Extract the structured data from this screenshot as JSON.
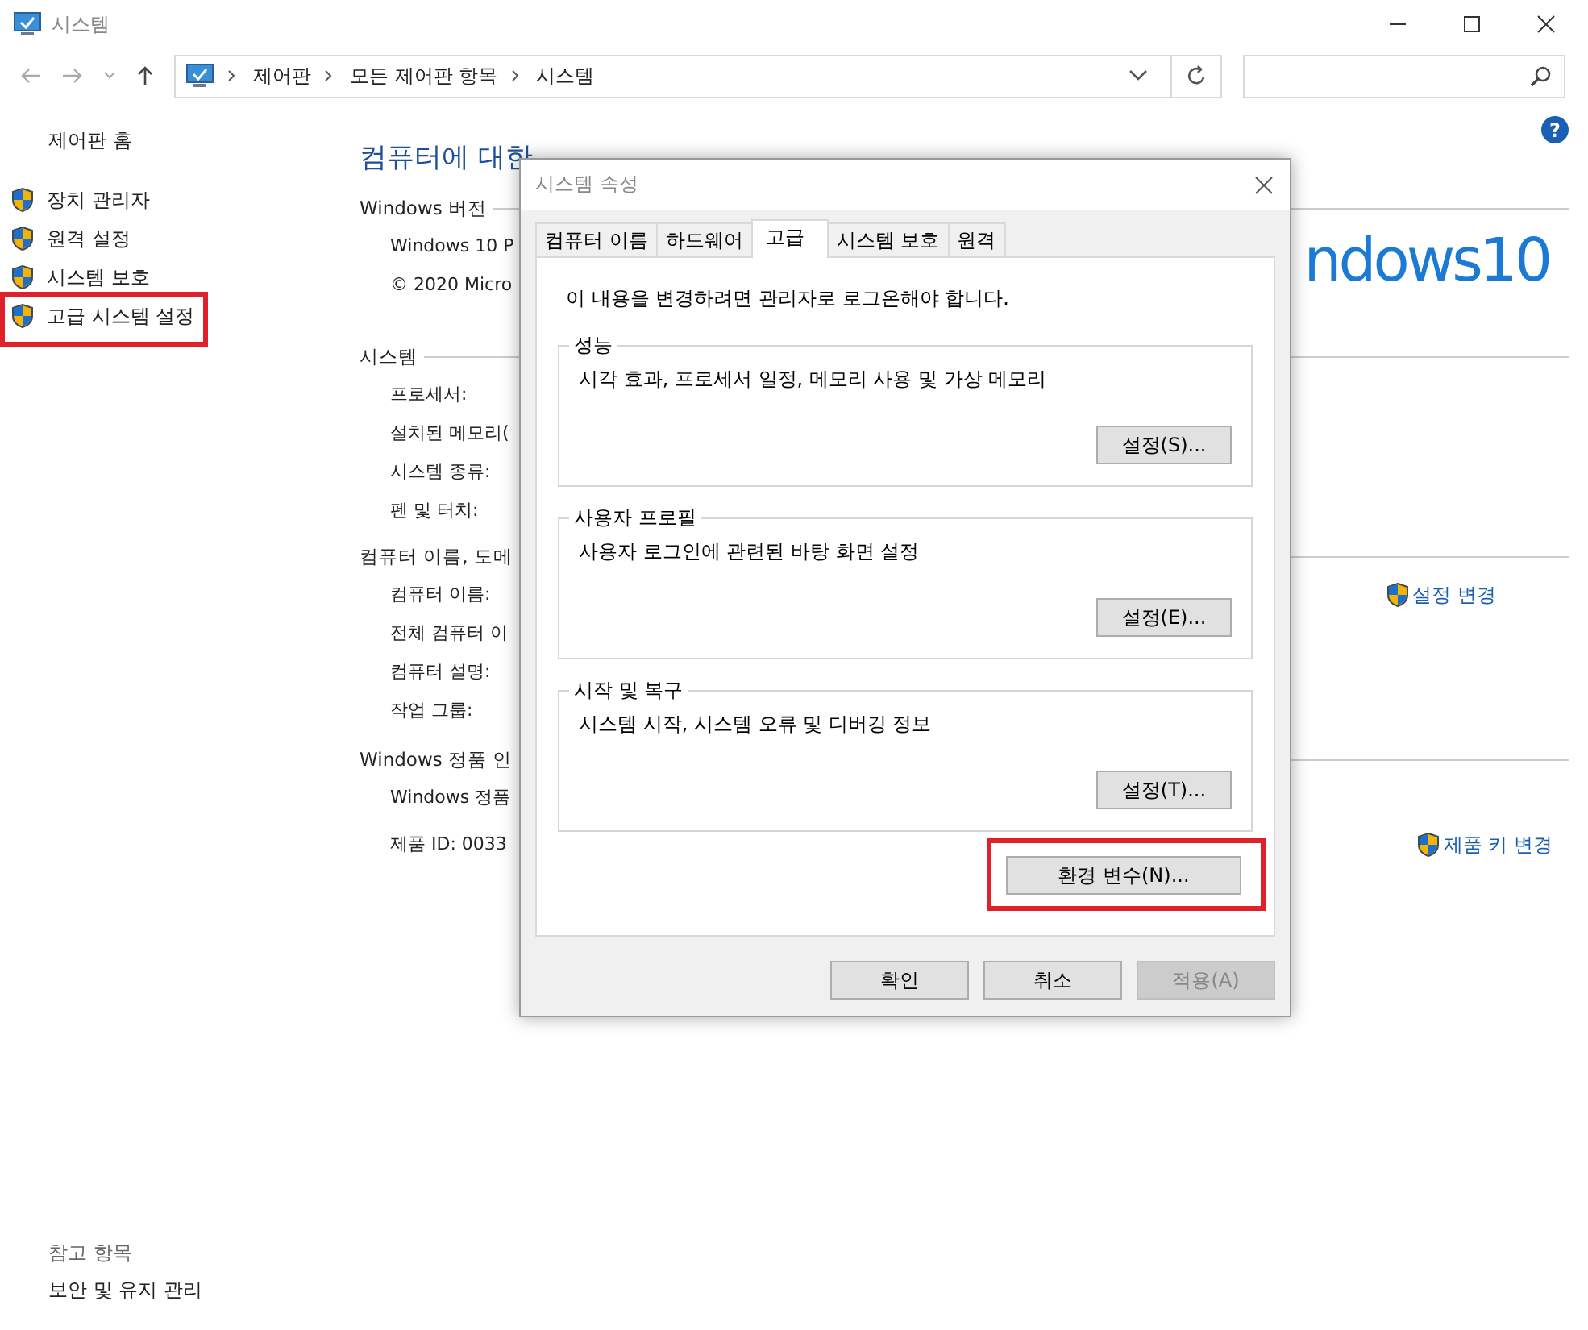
{
  "window": {
    "title": "시스템"
  },
  "nav": {
    "breadcrumb": [
      "제어판",
      "모든 제어판 항목",
      "시스템"
    ]
  },
  "help": "?",
  "sidebar": {
    "home": "제어판 홈",
    "items": [
      {
        "label": "장치 관리자",
        "highlighted": false
      },
      {
        "label": "원격 설정",
        "highlighted": false
      },
      {
        "label": "시스템 보호",
        "highlighted": false
      },
      {
        "label": "고급 시스템 설정",
        "highlighted": true
      }
    ],
    "see_also_title": "참고 항목",
    "see_also": [
      "보안 및 유지 관리"
    ]
  },
  "main": {
    "heading": "컴퓨터에 대한",
    "logo": "ndows10",
    "sections": [
      {
        "title": "Windows 버전",
        "rows": [
          "Windows 10 P",
          "© 2020 Micro"
        ]
      },
      {
        "title": "시스템",
        "rows": [
          "프로세서:",
          "설치된 메모리(",
          "시스템 종류:",
          "펜 및 터치:"
        ]
      },
      {
        "title": "컴퓨터 이름, 도메",
        "rows": [
          "컴퓨터 이름:",
          "전체 컴퓨터 이",
          "컴퓨터 설명:",
          "작업 그룹:"
        ],
        "link": "설정 변경"
      },
      {
        "title": "Windows 정품 인",
        "rows": [
          "Windows 정품",
          "제품 ID: 0033"
        ],
        "link": "제품 키 변경"
      }
    ]
  },
  "dialog": {
    "title": "시스템 속성",
    "tabs": [
      {
        "label": "컴퓨터 이름",
        "selected": false
      },
      {
        "label": "하드웨어",
        "selected": false
      },
      {
        "label": "고급",
        "selected": true
      },
      {
        "label": "시스템 보호",
        "selected": false
      },
      {
        "label": "원격",
        "selected": false
      }
    ],
    "notice": "이 내용을 변경하려면 관리자로 로그온해야 합니다.",
    "groups": [
      {
        "title": "성능",
        "description": "시각 효과, 프로세서 일정, 메모리 사용 및 가상 메모리",
        "button": "설정(S)..."
      },
      {
        "title": "사용자 프로필",
        "description": "사용자 로그인에 관련된 바탕 화면 설정",
        "button": "설정(E)..."
      },
      {
        "title": "시작 및 복구",
        "description": "시스템 시작, 시스템 오류 및 디버깅 정보",
        "button": "설정(T)..."
      }
    ],
    "env_button": {
      "label": "환경 변수(N)...",
      "highlighted": true
    },
    "buttons": [
      {
        "label": "확인",
        "disabled": false
      },
      {
        "label": "취소",
        "disabled": false
      },
      {
        "label": "적용(A)",
        "disabled": true
      }
    ]
  }
}
